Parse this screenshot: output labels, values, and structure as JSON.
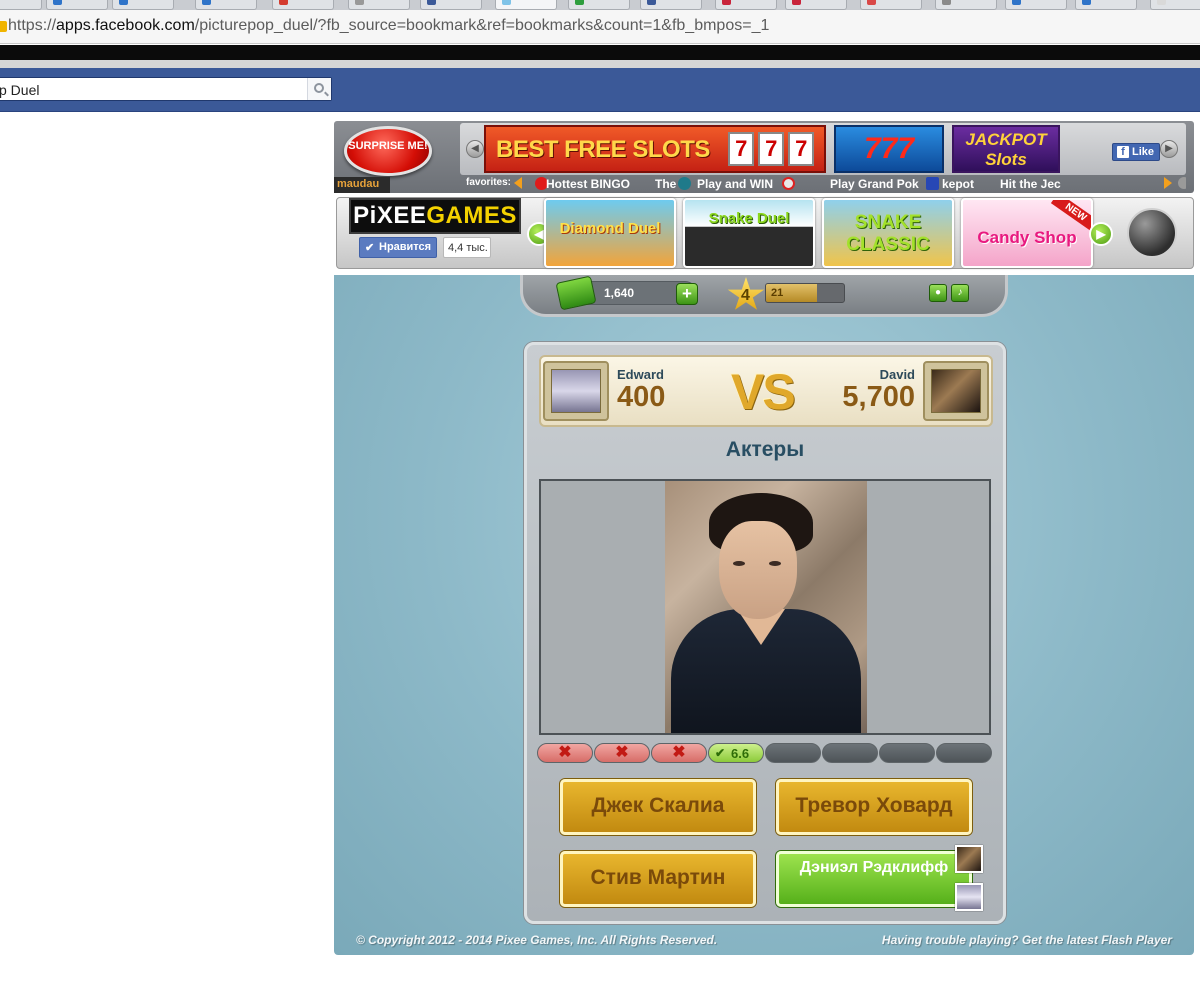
{
  "browser": {
    "url_prefix": "https://",
    "url_host": "apps.facebook.com",
    "url_path": "/picturepop_duel/?fb_source=bookmark&ref=bookmarks&count=1&fb_bmpos=_1"
  },
  "facebook": {
    "search_value": "p Duel"
  },
  "ad_banner": {
    "surprise_label": "SURPRISE ME!",
    "brand": "maudau",
    "slots_title": "BEST FREE SLOTS",
    "sevens_title": "777",
    "jackpot_title": "JACKPOT Slots",
    "like_label": "Like",
    "favorites_label": "favorites:",
    "favorites": [
      "Hottest BINGO",
      "The",
      "Play and WIN",
      "Play Grand Pok",
      "kepot",
      "Hit the Jec"
    ]
  },
  "games_bar": {
    "logo_left": "PiXEE",
    "logo_right": "GAMES",
    "like_label": "Нравится",
    "like_count": "4,4 тыс.",
    "games": [
      "Diamond Duel",
      "Snake Duel",
      "SNAKE CLASSIC",
      "Candy Shop"
    ],
    "new_badge": "NEW"
  },
  "hud": {
    "money": "1,640",
    "plus_label": "+",
    "level": "4",
    "xp": "21",
    "xp_progress": 0.65
  },
  "duel": {
    "player1_name": "Edward",
    "player1_score": "400",
    "vs_label": "VS",
    "player2_name": "David",
    "player2_score": "5,700",
    "category": "Актеры",
    "progress_right_value": "6.6",
    "answers": [
      "Джек Скалиа",
      "Тревор Ховард",
      "Стив Мартин",
      "Дэниэл Рэдклифф"
    ]
  },
  "footer": {
    "copyright": "© Copyright 2012 - 2014 Pixee Games, Inc.  All Rights Reserved.",
    "help": "Having trouble playing? Get the latest Flash Player"
  },
  "colors": {
    "facebook_blue": "#3b5998",
    "stage_bg": "#8db9c8",
    "answer_gold": "#e8b62e",
    "answer_correct": "#56b01a"
  }
}
